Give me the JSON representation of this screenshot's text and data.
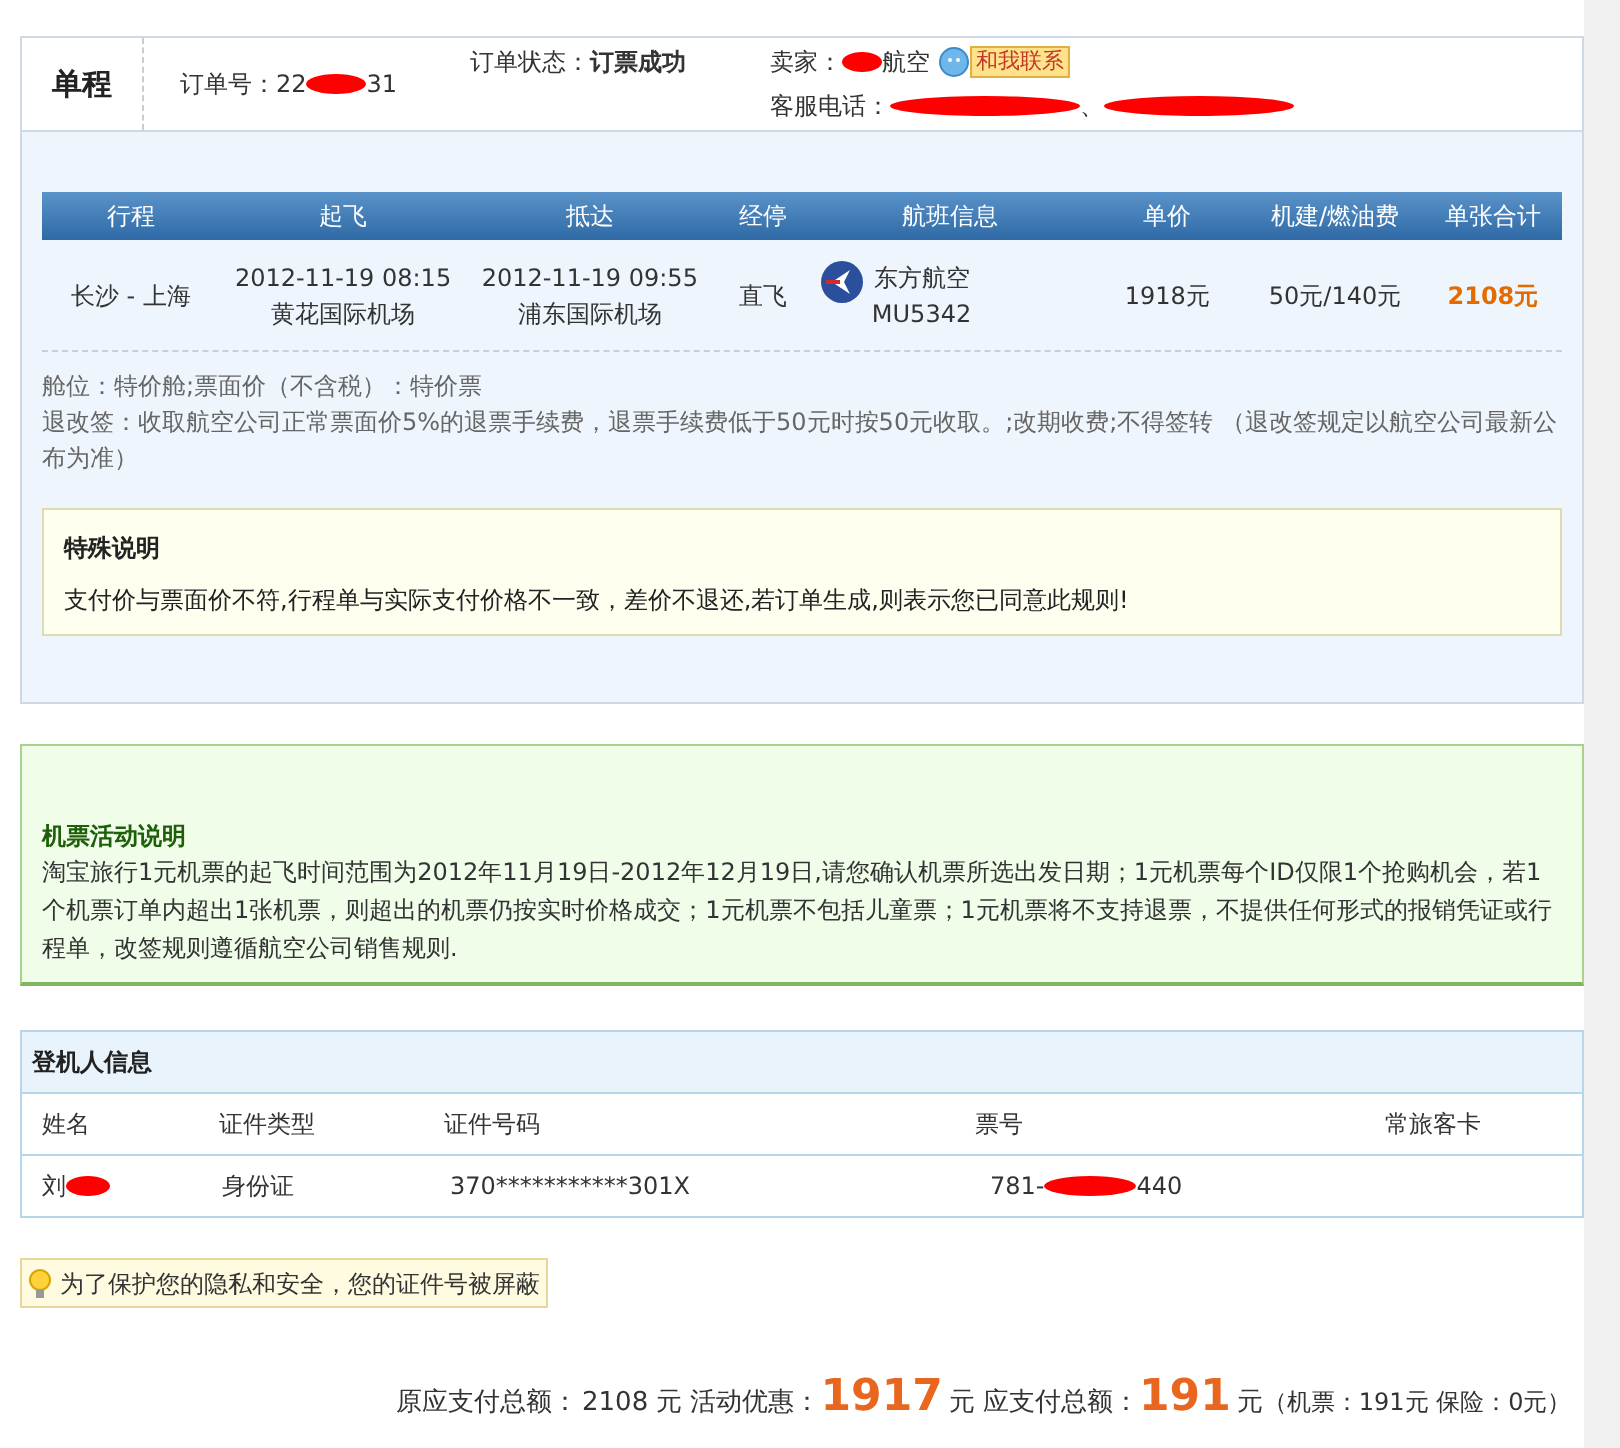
{
  "header": {
    "trip_type": "单程",
    "order_no_label": "订单号：",
    "order_no_start": "22",
    "order_no_end": "31",
    "status_label": "订单状态：",
    "status": "订票成功",
    "seller_label": "卖家：",
    "seller_end": "航空",
    "contact_button": "和我联系",
    "phone_label": "客服电话：",
    "phone_sep": "、"
  },
  "flight_table": {
    "columns": [
      "行程",
      "起飞",
      "抵达",
      "经停",
      "航班信息",
      "单价",
      "机建/燃油费",
      "单张合计"
    ],
    "rows": [
      {
        "route": "长沙 - 上海",
        "depart_time": "2012-11-19 08:15",
        "depart_airport": "黄花国际机场",
        "arrive_time": "2012-11-19 09:55",
        "arrive_airport": "浦东国际机场",
        "stops": "直飞",
        "airline": "东方航空",
        "flight_no": "MU5342",
        "price": "1918元",
        "fees": "50元/140元",
        "total": "2108元"
      }
    ]
  },
  "notes": [
    "舱位：特价舱;票面价（不含税）：特价票",
    "退改签：收取航空公司正常票面价5%的退票手续费，退票手续费低于50元时按50元收取。;改期收费;不得签转 （退改签规定以航空公司最新公布为准）"
  ],
  "special_note": {
    "title": "特殊说明",
    "text": "支付价与票面价不符,行程单与实际支付价格不一致，差价不退还,若订单生成,则表示您已同意此规则!"
  },
  "promo": {
    "title": "机票活动说明",
    "text": "淘宝旅行1元机票的起飞时间范围为2012年11月19日-2012年12月19日,请您确认机票所选出发日期；1元机票每个ID仅限1个抢购机会，若1个机票订单内超出1张机票，则超出的机票仍按实时价格成交；1元机票不包括儿童票；1元机票将不支持退票，不提供任何形式的报销凭证或行程单，改签规则遵循航空公司销售规则."
  },
  "passengers": {
    "title": "登机人信息",
    "columns": [
      "姓名",
      "证件类型",
      "证件号码",
      "票号",
      "常旅客卡"
    ],
    "rows": [
      {
        "name_start": "刘",
        "id_type": "身份证",
        "id_no": "370***********301X",
        "ticket_start": "781-",
        "ticket_end": "440"
      }
    ]
  },
  "privacy_tip": "为了保护您的隐私和安全，您的证件号被屏蔽",
  "totals": {
    "original_label": "原应支付总额：",
    "original": "2108 元",
    "discount_label": "活动优惠：",
    "discount": "1917",
    "discount_unit": "元",
    "payable_label": "应支付总额：",
    "payable": "191",
    "payable_unit": "元",
    "breakdown": "（机票：191元 保险：0元）"
  }
}
